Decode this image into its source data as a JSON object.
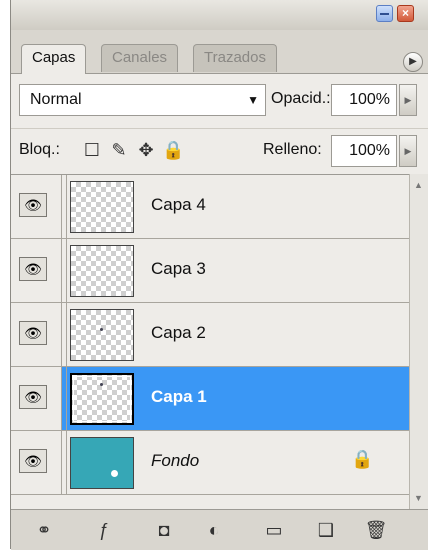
{
  "tabs": [
    {
      "label": "Capas",
      "active": true
    },
    {
      "label": "Canales",
      "active": false
    },
    {
      "label": "Trazados",
      "active": false
    }
  ],
  "blend_mode": {
    "value": "Normal"
  },
  "opacity": {
    "label": "Opacid.:",
    "value": "100%"
  },
  "lock": {
    "label": "Bloq.:",
    "icons": [
      "transparency-lock-icon",
      "brush-lock-icon",
      "move-lock-icon",
      "padlock-icon"
    ]
  },
  "fill": {
    "label": "Relleno:",
    "value": "100%"
  },
  "layers": [
    {
      "name": "Capa 4",
      "visible": true,
      "selected": false
    },
    {
      "name": "Capa 3",
      "visible": true,
      "selected": false
    },
    {
      "name": "Capa 2",
      "visible": true,
      "selected": false
    },
    {
      "name": "Capa 1",
      "visible": true,
      "selected": true
    },
    {
      "name": "Fondo",
      "visible": true,
      "selected": false,
      "locked": true
    }
  ],
  "colors": {
    "selection": "#3a97f5",
    "background_thumb": "#36a7b6"
  },
  "bottom_toolbar": [
    "link-icon",
    "layer-style-icon",
    "mask-icon",
    "adjustment-layer-icon",
    "group-folder-icon",
    "new-layer-icon",
    "trash-icon"
  ]
}
